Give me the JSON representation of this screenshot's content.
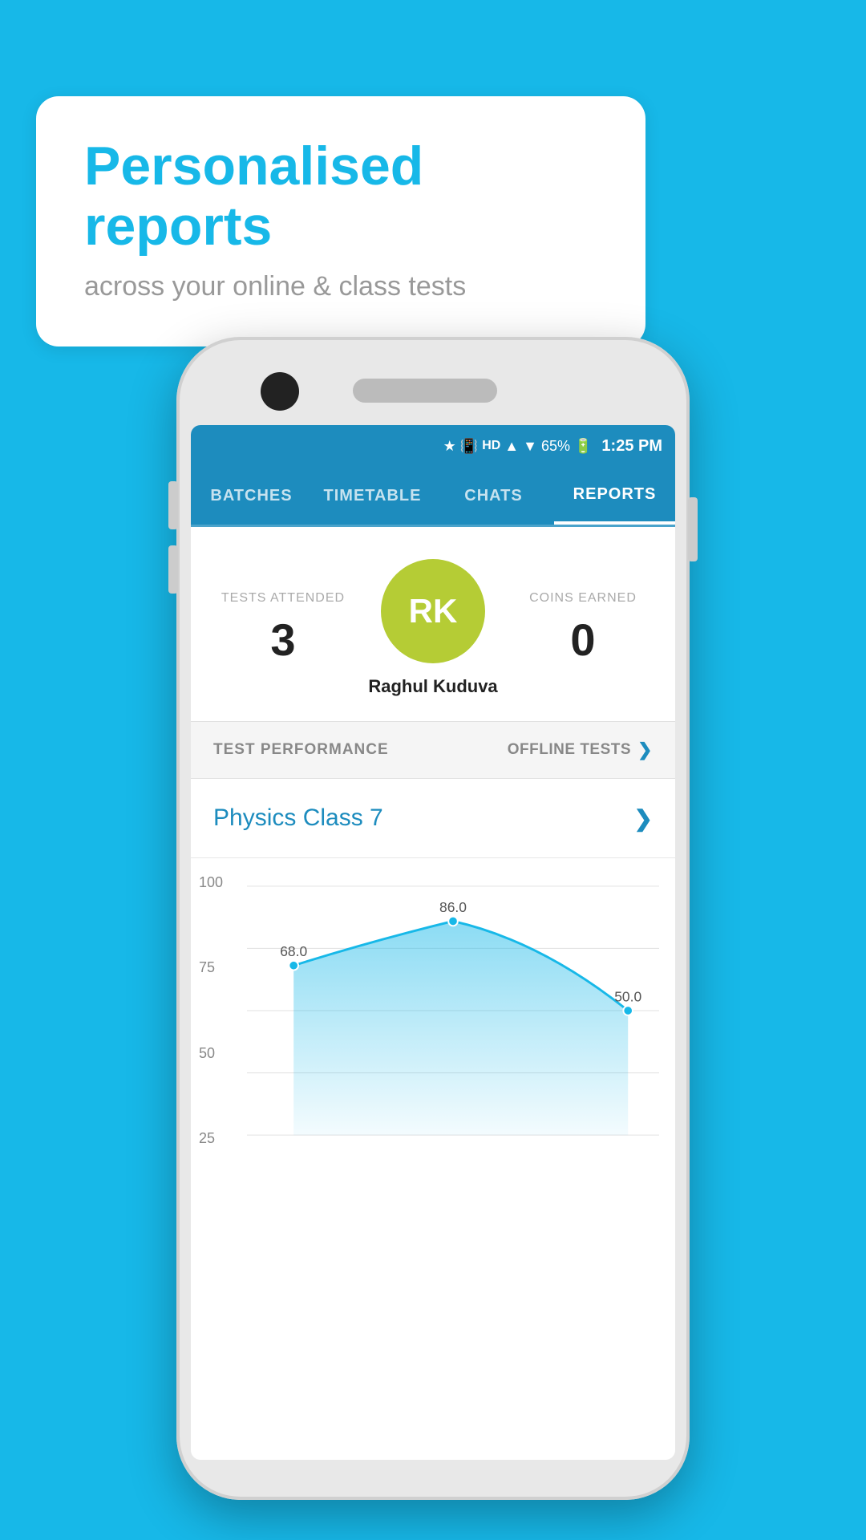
{
  "background_color": "#17b8e8",
  "bubble": {
    "title": "Personalised reports",
    "subtitle": "across your online & class tests"
  },
  "status_bar": {
    "time": "1:25 PM",
    "battery": "65%",
    "icons": "🔵 📳 HD ▲ ▼ 📶 ✕ 🔋"
  },
  "nav": {
    "tabs": [
      {
        "id": "batches",
        "label": "BATCHES",
        "active": false
      },
      {
        "id": "timetable",
        "label": "TIMETABLE",
        "active": false
      },
      {
        "id": "chats",
        "label": "CHATS",
        "active": false
      },
      {
        "id": "reports",
        "label": "REPORTS",
        "active": true
      }
    ]
  },
  "profile": {
    "tests_attended_label": "TESTS ATTENDED",
    "tests_attended_value": "3",
    "coins_earned_label": "COINS EARNED",
    "coins_earned_value": "0",
    "avatar_initials": "RK",
    "avatar_name": "Raghul Kuduva"
  },
  "performance": {
    "section_label": "TEST PERFORMANCE",
    "filter_label": "OFFLINE TESTS"
  },
  "class_item": {
    "name": "Physics Class 7"
  },
  "chart": {
    "y_labels": [
      "100",
      "75",
      "50",
      "25"
    ],
    "data_points": [
      {
        "x": 0,
        "y": 68.0,
        "label": "68.0"
      },
      {
        "x": 1,
        "y": 86.0,
        "label": "86.0"
      },
      {
        "x": 2,
        "y": 50.0,
        "label": "50.0"
      }
    ]
  }
}
